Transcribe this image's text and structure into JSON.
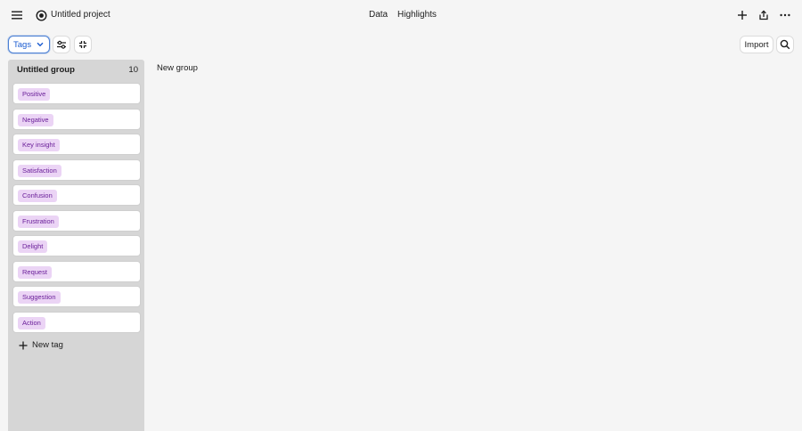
{
  "header": {
    "project_title": "Untitled project",
    "tabs": [
      {
        "label": "Data"
      },
      {
        "label": "Highlights"
      }
    ]
  },
  "toolbar": {
    "tags_select_value": "Tags",
    "import_label": "Import"
  },
  "group": {
    "title": "Untitled group",
    "count": "10",
    "tags": [
      {
        "label": "Positive"
      },
      {
        "label": "Negative"
      },
      {
        "label": "Key insight"
      },
      {
        "label": "Satisfaction"
      },
      {
        "label": "Confusion"
      },
      {
        "label": "Frustration"
      },
      {
        "label": "Delight"
      },
      {
        "label": "Request"
      },
      {
        "label": "Suggestion"
      },
      {
        "label": "Action"
      }
    ],
    "new_tag_label": "New tag"
  },
  "new_group_label": "New group",
  "colors": {
    "tag_pill_bg": "#ebd4f5",
    "tag_pill_text": "#6a1f99",
    "accent": "#1a5bd0"
  }
}
